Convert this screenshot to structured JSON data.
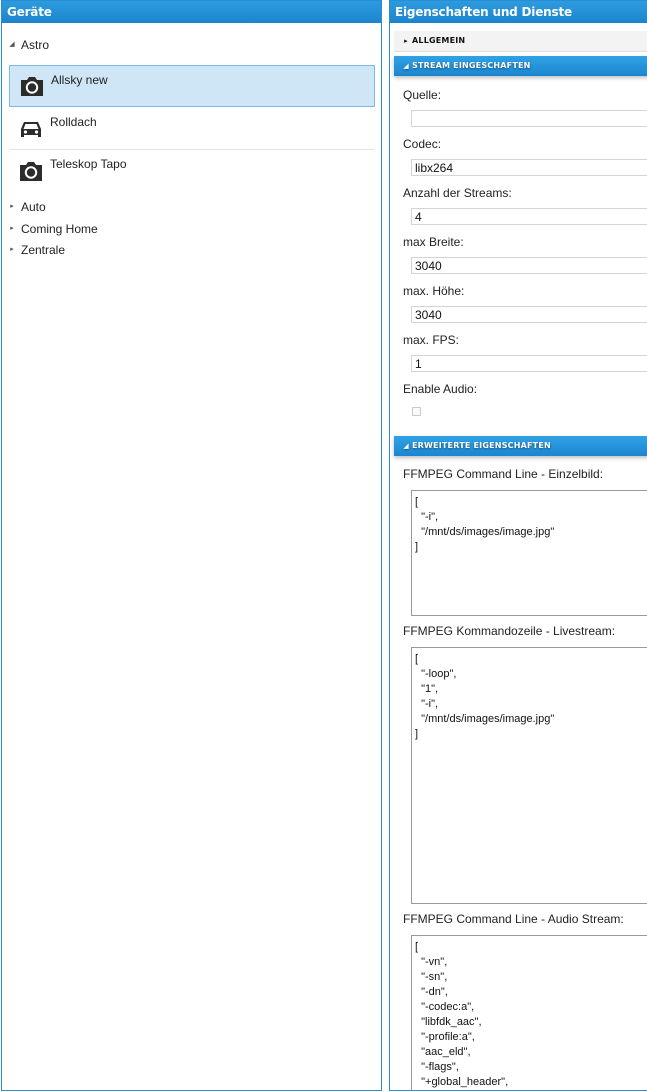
{
  "left_panel": {
    "title": "Geräte",
    "tree": {
      "astro": {
        "label": "Astro",
        "toggle": "expanded"
      },
      "devices": [
        {
          "label": "Allsky new",
          "icon": "camera-icon",
          "selected": true
        },
        {
          "label": "Rolldach",
          "icon": "car-icon",
          "selected": false
        },
        {
          "label": "Teleskop Tapo",
          "icon": "camera-icon",
          "selected": false
        }
      ],
      "groups": [
        {
          "label": "Auto",
          "toggle": "collapsed"
        },
        {
          "label": "Coming Home",
          "toggle": "collapsed"
        },
        {
          "label": "Zentrale",
          "toggle": "collapsed"
        }
      ]
    }
  },
  "right_panel": {
    "title": "Eigenschaften und Dienste",
    "sections": {
      "allgemein": {
        "label": "ALLGEMEIN",
        "state": "collapsed"
      },
      "stream": {
        "label": "STREAM EINGESCHAFTEN",
        "state": "expanded"
      },
      "erweitert": {
        "label": "ERWEITERTE EIGENSCHAFTEN",
        "state": "expanded"
      }
    },
    "fields": {
      "quelle": {
        "label": "Quelle:",
        "value": ""
      },
      "codec": {
        "label": "Codec:",
        "value": "libx264"
      },
      "anzahl_streams": {
        "label": "Anzahl der Streams:",
        "value": "4"
      },
      "max_breite": {
        "label": "max Breite:",
        "value": "3040"
      },
      "max_hoehe": {
        "label": "max. Höhe:",
        "value": "3040"
      },
      "max_fps": {
        "label": "max. FPS:",
        "value": "1"
      },
      "enable_audio": {
        "label": "Enable Audio:",
        "checked": false
      }
    },
    "advanced": {
      "einzelbild": {
        "label": "FFMPEG Command Line - Einzelbild:",
        "value": "[\n  \"-i\",\n  \"/mnt/ds/images/image.jpg\"\n]"
      },
      "livestream": {
        "label": "FFMPEG Kommandozeile - Livestream:",
        "value": "[\n  \"-loop\",\n  \"1\",\n  \"-i\",\n  \"/mnt/ds/images/image.jpg\"\n]"
      },
      "audio_stream": {
        "label": "FFMPEG Command Line - Audio Stream:",
        "value": "[\n  \"-vn\",\n  \"-sn\",\n  \"-dn\",\n  \"-codec:a\",\n  \"libfdk_aac\",\n  \"-profile:a\",\n  \"aac_eld\",\n  \"-flags\",\n  \"+global_header\","
      }
    }
  }
}
